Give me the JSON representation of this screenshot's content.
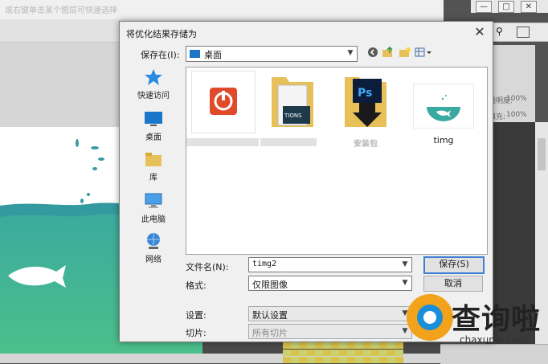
{
  "background": {
    "hint_text": "或右键单击某个图层可快速选择",
    "panel_labels": {
      "opacity": "透明度:",
      "opacity_value": "100%",
      "fill": "填充:",
      "fill_value": "100%"
    }
  },
  "dialog": {
    "title": "将优化结果存储为",
    "close_glyph": "✕",
    "save_in_label": "保存在(I):",
    "save_in_value": "桌面",
    "places": [
      {
        "label": "快速访问",
        "icon": "star-icon"
      },
      {
        "label": "桌面",
        "icon": "desktop-icon"
      },
      {
        "label": "库",
        "icon": "library-icon"
      },
      {
        "label": "此电脑",
        "icon": "computer-icon"
      },
      {
        "label": "网络",
        "icon": "network-icon"
      }
    ],
    "files": [
      {
        "label": "",
        "icon": "app-power-icon"
      },
      {
        "label": "",
        "icon": "folder-actions-icon"
      },
      {
        "label": "安装包",
        "icon": "photoshop-installer-icon"
      },
      {
        "label": "timg",
        "icon": "image-thumbnail"
      }
    ],
    "filename_label": "文件名(N):",
    "filename_value": "timg2",
    "format_label": "格式:",
    "format_value": "仅限图像",
    "settings_label": "设置:",
    "settings_value": "默认设置",
    "slices_label": "切片:",
    "slices_value": "所有切片",
    "save_button": "保存(S)",
    "cancel_button": "取消"
  },
  "watermark": {
    "brand": "查询啦",
    "url": "chaxunla.com"
  },
  "colors": {
    "accent": "#1b75c9",
    "button_focus": "#3c7fd4",
    "teal": "#3aa9a0"
  }
}
